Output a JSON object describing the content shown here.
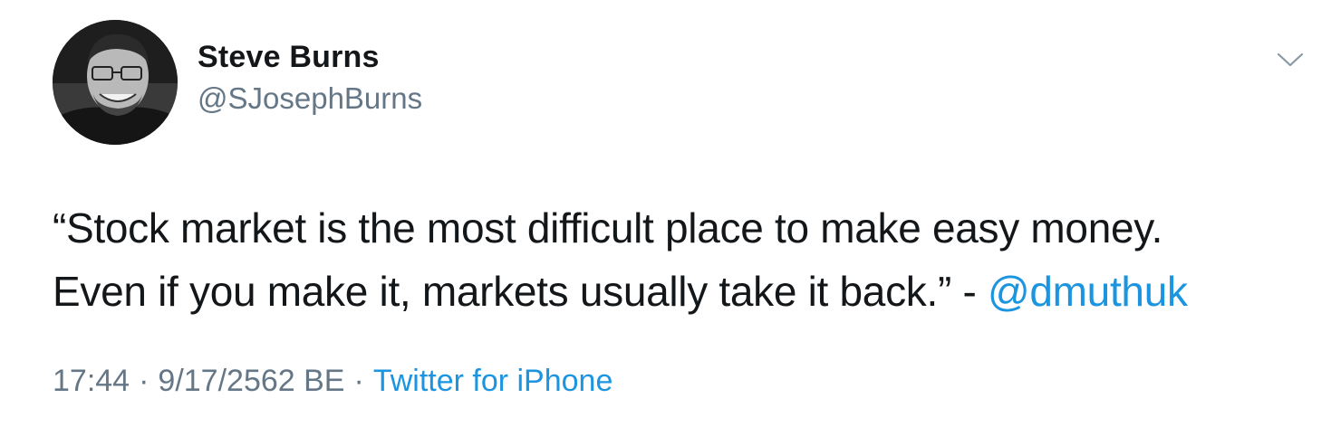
{
  "tweet": {
    "author": {
      "display_name": "Steve Burns",
      "handle": "@SJosephBurns"
    },
    "text": {
      "line1": "“Stock market is the most difficult place to make easy money.",
      "line2": "Even if you make it, markets usually take it back.” - ",
      "mention": "@dmuthuk"
    },
    "meta": {
      "time": "17:44",
      "separator": "·",
      "date": "9/17/2562 BE",
      "source": "Twitter for iPhone"
    },
    "menu_icon": "chevron-down-icon",
    "colors": {
      "link": "#1b95e0",
      "secondary": "#657786",
      "primary": "#14171a"
    }
  }
}
